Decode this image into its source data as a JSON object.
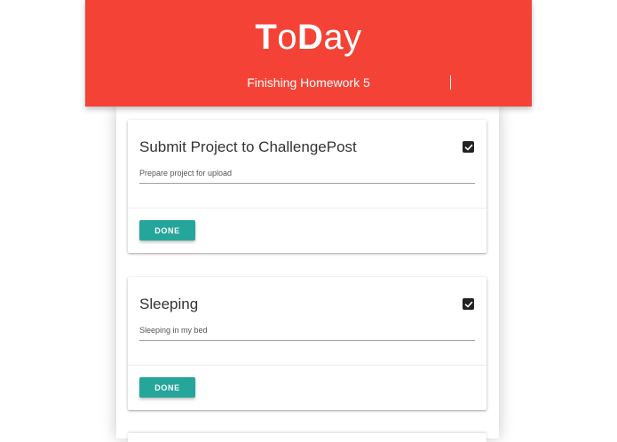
{
  "header": {
    "logo": {
      "part1": "T",
      "part2": "o",
      "part3": "D",
      "part4": "ay"
    },
    "task_input_value": "Finishing Homework 5",
    "background_color": "#f44336"
  },
  "cards": [
    {
      "title": "Submit Project to ChallengePost",
      "description": "Prepare project for upload",
      "checked": true,
      "button_label": "DONE"
    },
    {
      "title": "Sleeping",
      "description": "Sleeping in my bed",
      "checked": true,
      "button_label": "DONE"
    }
  ],
  "colors": {
    "accent": "#26a69a",
    "checkbox": "#222222"
  },
  "icons": {
    "checkbox": "check-icon"
  }
}
